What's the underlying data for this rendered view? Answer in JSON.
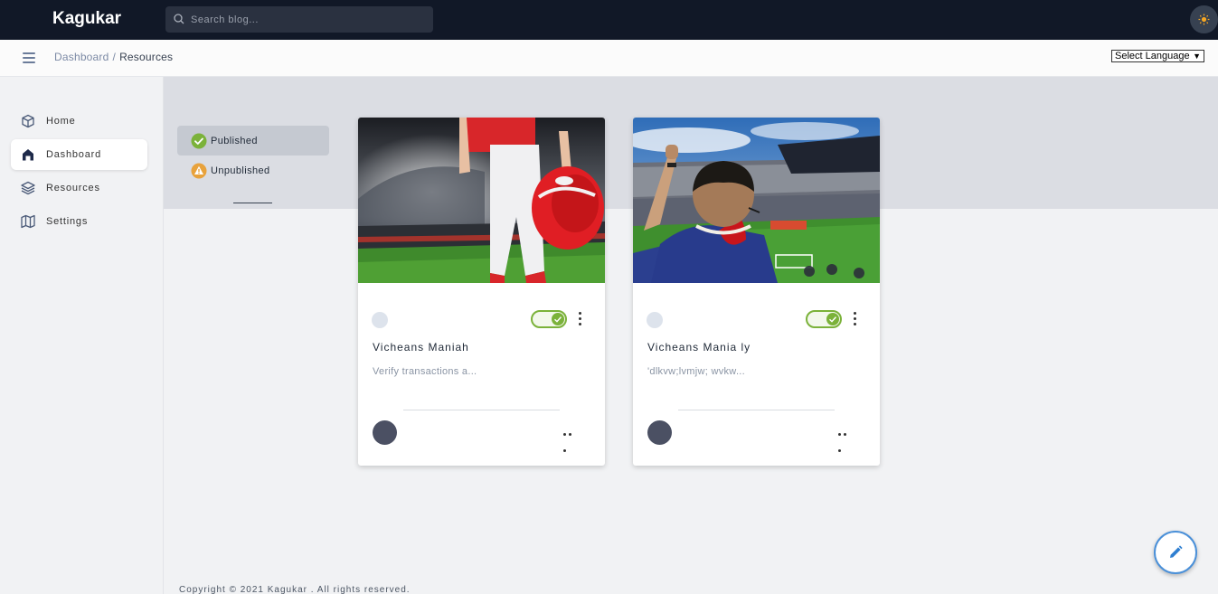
{
  "header": {
    "brand": "Kagukar",
    "search_placeholder": "Search blog...",
    "search_icon": "search-icon",
    "theme_icon": "sun-icon"
  },
  "breadcrumb": {
    "items": [
      "Dashboard",
      "Resources"
    ],
    "separator": "/"
  },
  "language_select": {
    "selected": "Select Language"
  },
  "sidebar": {
    "items": [
      {
        "label": "Home",
        "icon": "cube-icon"
      },
      {
        "label": "Dashboard",
        "icon": "home-icon",
        "active": true
      },
      {
        "label": "Resources",
        "icon": "layers-icon"
      },
      {
        "label": "Settings",
        "icon": "map-icon"
      }
    ]
  },
  "tabs": [
    {
      "label": "Published",
      "icon": "check-circle-icon",
      "active": true,
      "color": "#7bb23a"
    },
    {
      "label": "Unpublished",
      "icon": "warning-icon",
      "active": false,
      "color": "#e8a23c"
    }
  ],
  "cards": [
    {
      "title": "Vicheans Maniah",
      "description": "Verify transactions a...",
      "published": true,
      "image": "football-player-holding-helmet-in-stadium"
    },
    {
      "title": "Vicheans Mania ly",
      "description": "'dlkvw;lvmjw; wvkw...",
      "published": true,
      "image": "fan-cheering-in-football-stadium"
    }
  ],
  "footer": {
    "text": "Copyright © 2021 Kagukar . All rights reserved."
  },
  "fab": {
    "icon": "pencil-icon"
  },
  "colors": {
    "topbar": "#111827",
    "accent_green": "#7bb23a",
    "fab_blue": "#4a90d9",
    "warning": "#e8a23c"
  }
}
